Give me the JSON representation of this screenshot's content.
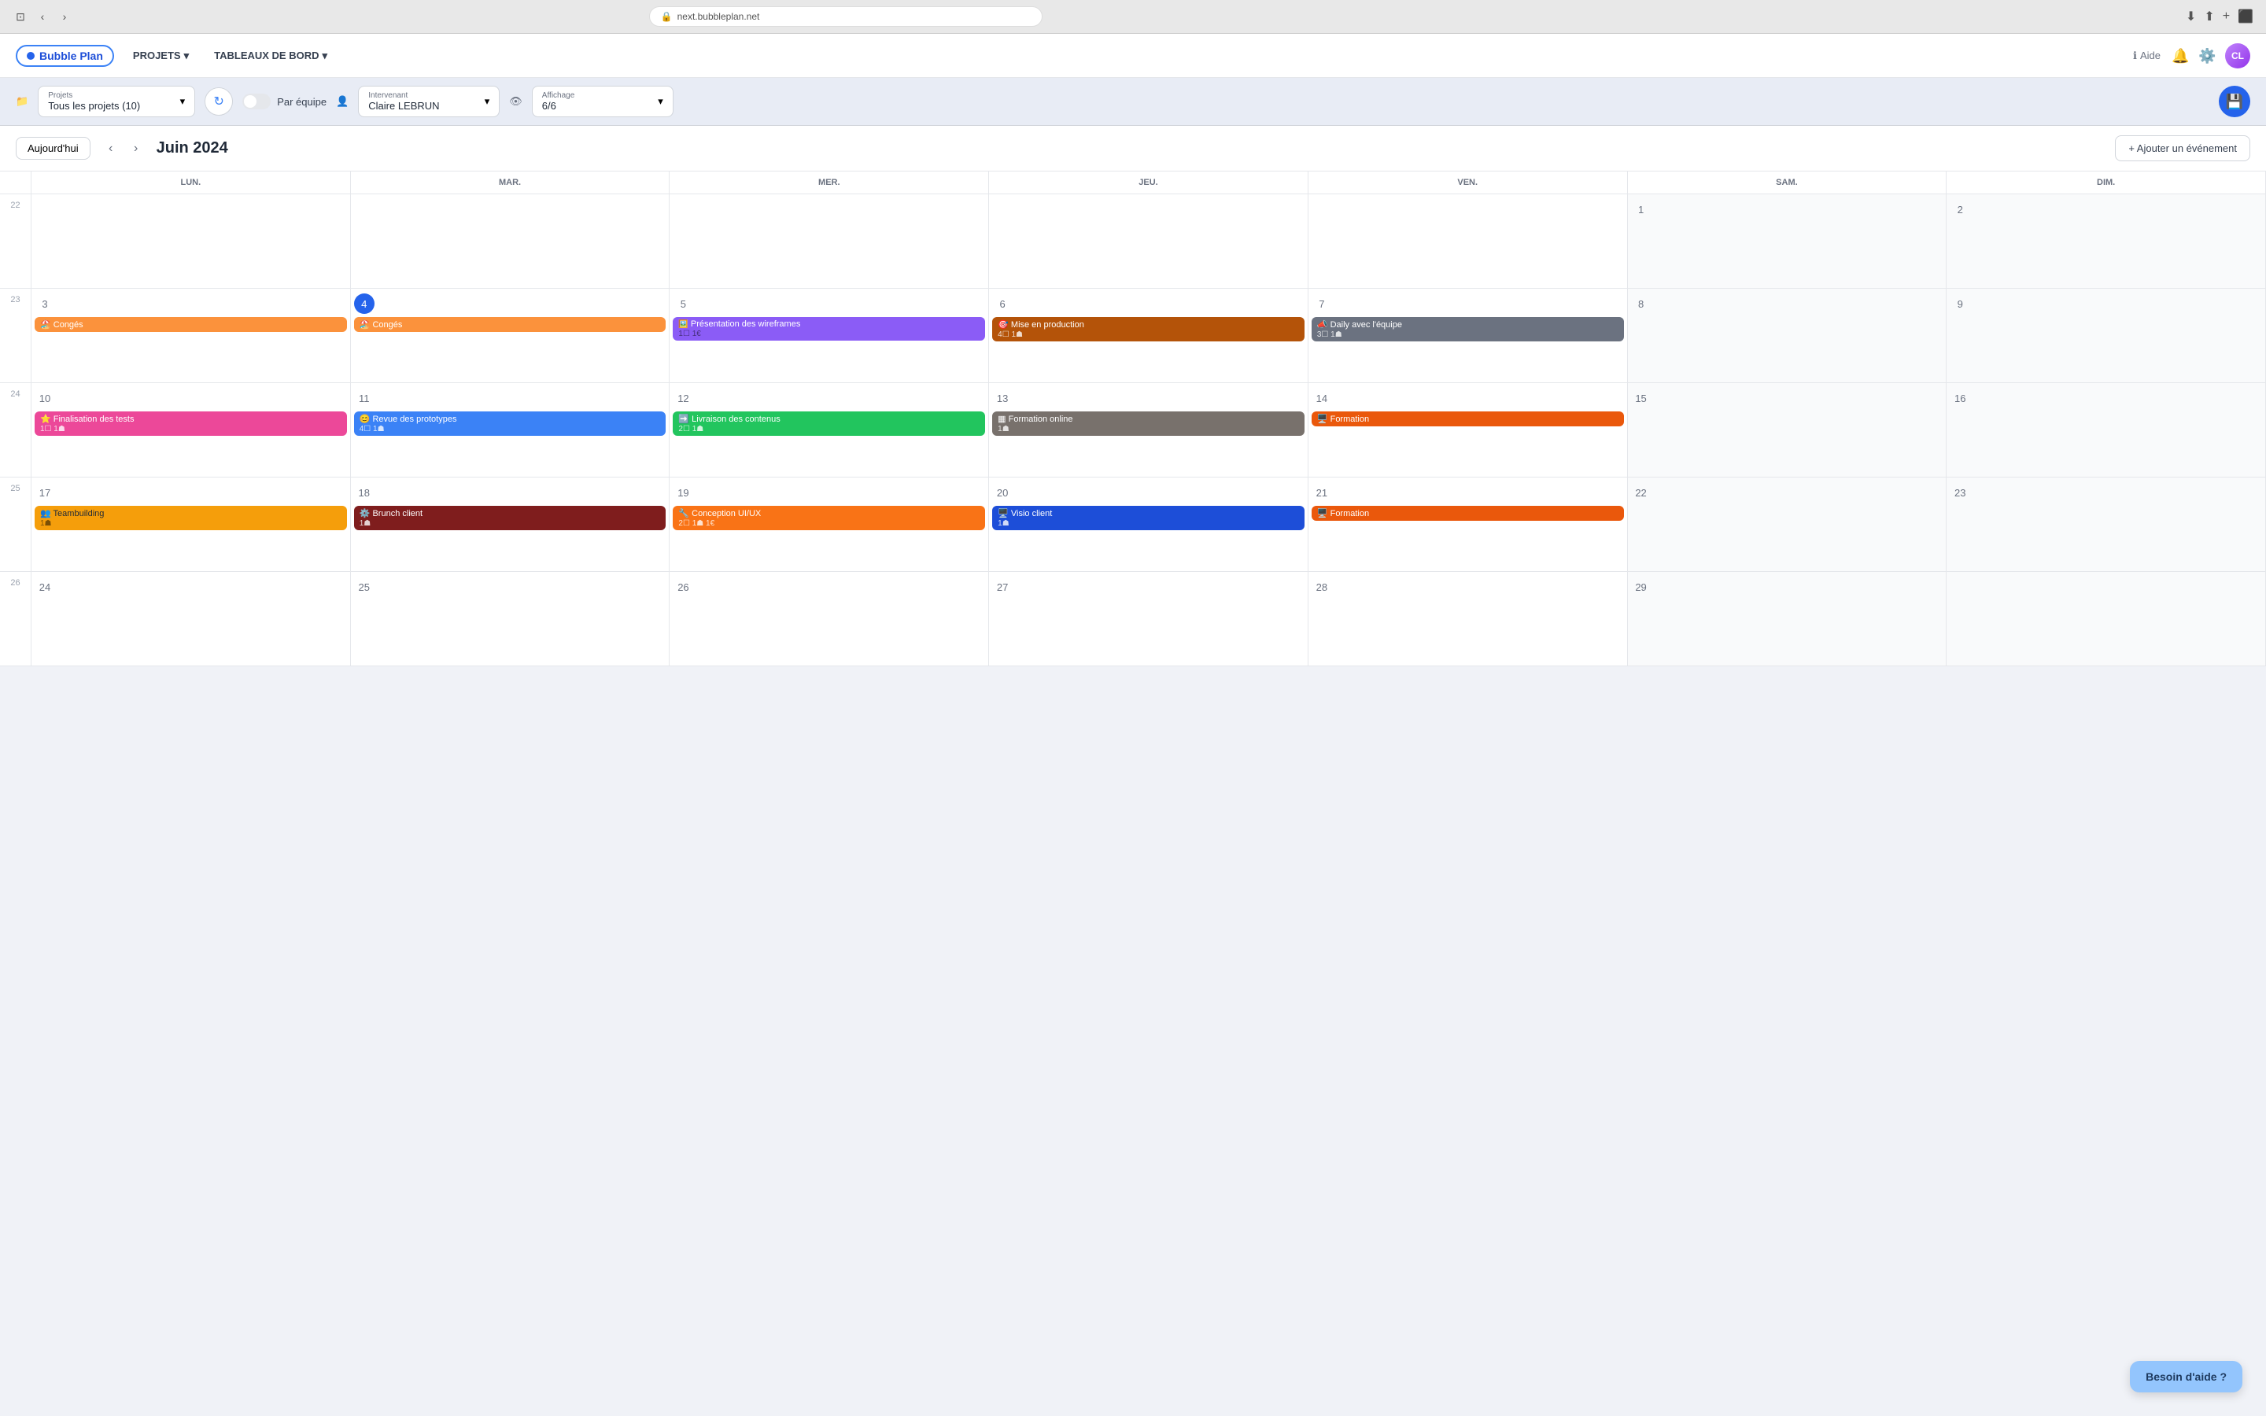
{
  "browser": {
    "url": "next.bubbleplan.net",
    "lock_icon": "🔒"
  },
  "app": {
    "logo": "Bubble Plan",
    "nav": {
      "projets": "PROJETS",
      "tableaux": "TABLEAUX DE BORD"
    },
    "header_right": {
      "help": "Aide",
      "notifications_icon": "🔔",
      "settings_icon": "⚙️"
    }
  },
  "toolbar": {
    "projects_label": "Projets",
    "projects_value": "Tous les projets (10)",
    "par_equipe": "Par équipe",
    "intervenant_label": "Intervenant",
    "intervenant_value": "Claire LEBRUN",
    "affichage_label": "Affichage",
    "affichage_value": "6/6"
  },
  "calendar": {
    "today_btn": "Aujourd'hui",
    "title": "Juin 2024",
    "add_event": "+ Ajouter un événement",
    "days": [
      "LUN.",
      "MAR.",
      "MER.",
      "JEU.",
      "VEN.",
      "SAM.",
      "DIM."
    ],
    "weeks": [
      {
        "week_num": "22",
        "days": [
          {
            "num": "",
            "weekend": false,
            "events": []
          },
          {
            "num": "",
            "weekend": false,
            "events": []
          },
          {
            "num": "",
            "weekend": false,
            "events": []
          },
          {
            "num": "",
            "weekend": false,
            "events": []
          },
          {
            "num": "",
            "weekend": false,
            "events": []
          },
          {
            "num": "1",
            "weekend": true,
            "events": []
          },
          {
            "num": "2",
            "weekend": true,
            "events": []
          }
        ]
      },
      {
        "week_num": "23",
        "days": [
          {
            "num": "3",
            "weekend": false,
            "events": [
              {
                "id": "conges1",
                "label": "🏖️ Congés",
                "class": "event-conges",
                "meta": ""
              }
            ]
          },
          {
            "num": "4",
            "weekend": false,
            "today": true,
            "events": [
              {
                "id": "conges2",
                "label": "🏖️ Congés",
                "class": "event-conges",
                "meta": ""
              }
            ]
          },
          {
            "num": "5",
            "weekend": false,
            "events": [
              {
                "id": "presentation",
                "label": "Présentation des wireframes",
                "class": "event-presentation",
                "meta": "1☐ 1€",
                "icon": "🖼️"
              }
            ]
          },
          {
            "num": "6",
            "weekend": false,
            "events": [
              {
                "id": "mise",
                "label": "Mise en production",
                "class": "event-mise-en-prod",
                "meta": "4☐ 1☗",
                "icon": "🎯"
              }
            ]
          },
          {
            "num": "7",
            "weekend": false,
            "events": [
              {
                "id": "daily",
                "label": "Daily avec l'équipe",
                "class": "event-daily",
                "meta": "3☐ 1☗",
                "icon": "📣"
              }
            ]
          },
          {
            "num": "8",
            "weekend": true,
            "events": []
          },
          {
            "num": "9",
            "weekend": true,
            "events": []
          }
        ]
      },
      {
        "week_num": "24",
        "days": [
          {
            "num": "10",
            "weekend": false,
            "events": [
              {
                "id": "finalisation",
                "label": "Finalisation des tests",
                "class": "event-finalisation",
                "meta": "1☐ 1☗",
                "icon": "⭐"
              }
            ]
          },
          {
            "num": "11",
            "weekend": false,
            "events": [
              {
                "id": "revue",
                "label": "Revue des prototypes",
                "class": "event-revue",
                "meta": "4☐ 1☗",
                "icon": "😊"
              }
            ]
          },
          {
            "num": "12",
            "weekend": false,
            "events": [
              {
                "id": "livraison",
                "label": "Livraison des contenus",
                "class": "event-livraison",
                "meta": "2☐ 1☗",
                "icon": "➡️"
              }
            ]
          },
          {
            "num": "13",
            "weekend": false,
            "events": [
              {
                "id": "formation-online",
                "label": "Formation online",
                "class": "event-formation-online",
                "meta": "1☗",
                "icon": "▦"
              }
            ]
          },
          {
            "num": "14",
            "weekend": false,
            "events": [
              {
                "id": "formation1",
                "label": "🖥️ Formation",
                "class": "event-formation",
                "meta": ""
              }
            ]
          },
          {
            "num": "15",
            "weekend": true,
            "events": []
          },
          {
            "num": "16",
            "weekend": true,
            "events": []
          }
        ]
      },
      {
        "week_num": "25",
        "days": [
          {
            "num": "17",
            "weekend": false,
            "events": [
              {
                "id": "teambuilding",
                "label": "Teambuilding",
                "class": "event-teambuilding",
                "meta": "1☗",
                "icon": "👥"
              }
            ]
          },
          {
            "num": "18",
            "weekend": false,
            "events": [
              {
                "id": "brunch",
                "label": "Brunch client",
                "class": "event-brunch",
                "meta": "1☗",
                "icon": "⚙️"
              }
            ]
          },
          {
            "num": "19",
            "weekend": false,
            "events": [
              {
                "id": "conception",
                "label": "Conception UI/UX",
                "class": "event-conception",
                "meta": "2☐ 1☗ 1€",
                "icon": "🔧"
              }
            ]
          },
          {
            "num": "20",
            "weekend": false,
            "events": [
              {
                "id": "visio",
                "label": "Visio client",
                "class": "event-visio",
                "meta": "1☗",
                "icon": "🖥️"
              }
            ]
          },
          {
            "num": "21",
            "weekend": false,
            "events": [
              {
                "id": "formation2",
                "label": "🖥️ Formation",
                "class": "event-formation",
                "meta": ""
              }
            ]
          },
          {
            "num": "22",
            "weekend": true,
            "events": []
          },
          {
            "num": "23",
            "weekend": true,
            "events": []
          }
        ]
      },
      {
        "week_num": "26",
        "days": [
          {
            "num": "24",
            "weekend": false,
            "events": []
          },
          {
            "num": "25",
            "weekend": false,
            "events": []
          },
          {
            "num": "26",
            "weekend": false,
            "events": []
          },
          {
            "num": "27",
            "weekend": false,
            "events": []
          },
          {
            "num": "28",
            "weekend": false,
            "events": []
          },
          {
            "num": "29",
            "weekend": true,
            "events": []
          },
          {
            "num": "",
            "weekend": true,
            "events": []
          }
        ]
      }
    ]
  },
  "help_bubble": "Besoin d'aide ?"
}
